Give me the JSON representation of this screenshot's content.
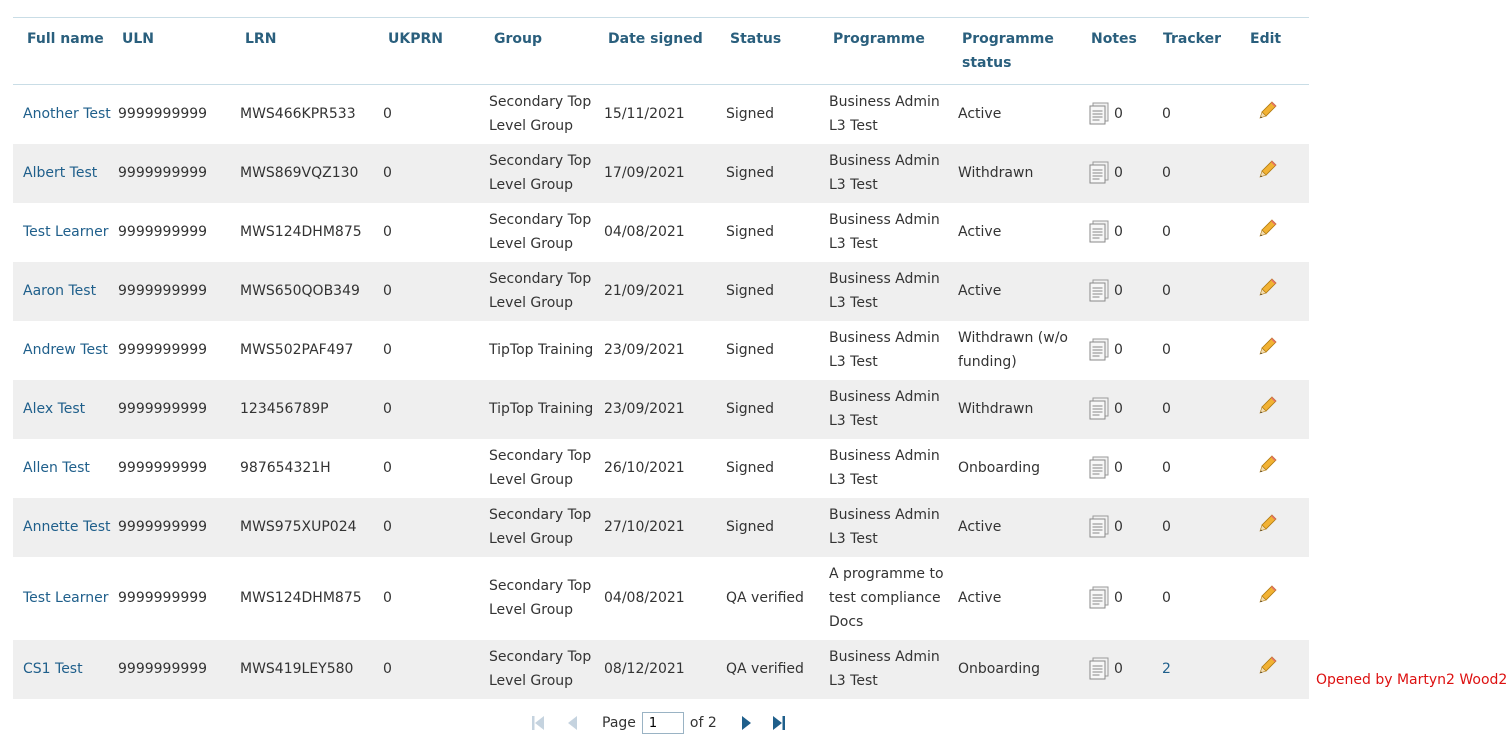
{
  "columns": [
    "Full name",
    "ULN",
    "LRN",
    "UKPRN",
    "Group",
    "Date signed",
    "Status",
    "Programme",
    "Programme status",
    "Notes",
    "Tracker",
    "Edit"
  ],
  "rows": [
    {
      "name": "Another Test",
      "uln": "9999999999",
      "lrn": "MWS466KPR533",
      "ukprn": "0",
      "group": "Secondary Top Level Group",
      "date": "15/11/2021",
      "status": "Signed",
      "programme": "Business Admin L3 Test",
      "prog_status": "Active",
      "notes": "0",
      "tracker": "0"
    },
    {
      "name": "Albert Test",
      "uln": "9999999999",
      "lrn": "MWS869VQZ130",
      "ukprn": "0",
      "group": "Secondary Top Level Group",
      "date": "17/09/2021",
      "status": "Signed",
      "programme": "Business Admin L3 Test",
      "prog_status": "Withdrawn",
      "notes": "0",
      "tracker": "0"
    },
    {
      "name": "Test Learner",
      "uln": "9999999999",
      "lrn": "MWS124DHM875",
      "ukprn": "0",
      "group": "Secondary Top Level Group",
      "date": "04/08/2021",
      "status": "Signed",
      "programme": "Business Admin L3 Test",
      "prog_status": "Active",
      "notes": "0",
      "tracker": "0"
    },
    {
      "name": "Aaron Test",
      "uln": "9999999999",
      "lrn": "MWS650QOB349",
      "ukprn": "0",
      "group": "Secondary Top Level Group",
      "date": "21/09/2021",
      "status": "Signed",
      "programme": "Business Admin L3 Test",
      "prog_status": "Active",
      "notes": "0",
      "tracker": "0"
    },
    {
      "name": "Andrew Test",
      "uln": "9999999999",
      "lrn": "MWS502PAF497",
      "ukprn": "0",
      "group": "TipTop Training",
      "date": "23/09/2021",
      "status": "Signed",
      "programme": "Business Admin L3 Test",
      "prog_status": "Withdrawn (w/o funding)",
      "notes": "0",
      "tracker": "0"
    },
    {
      "name": "Alex Test",
      "uln": "9999999999",
      "lrn": "123456789P",
      "ukprn": "0",
      "group": "TipTop Training",
      "date": "23/09/2021",
      "status": "Signed",
      "programme": "Business Admin L3 Test",
      "prog_status": "Withdrawn",
      "notes": "0",
      "tracker": "0"
    },
    {
      "name": "Allen Test",
      "uln": "9999999999",
      "lrn": "987654321H",
      "ukprn": "0",
      "group": "Secondary Top Level Group",
      "date": "26/10/2021",
      "status": "Signed",
      "programme": "Business Admin L3 Test",
      "prog_status": "Onboarding",
      "notes": "0",
      "tracker": "0"
    },
    {
      "name": "Annette Test",
      "uln": "9999999999",
      "lrn": "MWS975XUP024",
      "ukprn": "0",
      "group": "Secondary Top Level Group",
      "date": "27/10/2021",
      "status": "Signed",
      "programme": "Business Admin L3 Test",
      "prog_status": "Active",
      "notes": "0",
      "tracker": "0"
    },
    {
      "name": "Test Learner",
      "uln": "9999999999",
      "lrn": "MWS124DHM875",
      "ukprn": "0",
      "group": "Secondary Top Level Group",
      "date": "04/08/2021",
      "status": "QA verified",
      "programme": "A programme to test compliance Docs",
      "prog_status": "Active",
      "notes": "0",
      "tracker": "0"
    },
    {
      "name": "CS1 Test",
      "uln": "9999999999",
      "lrn": "MWS419LEY580",
      "ukprn": "0",
      "group": "Secondary Top Level Group",
      "date": "08/12/2021",
      "status": "QA verified",
      "programme": "Business Admin L3 Test",
      "prog_status": "Onboarding",
      "notes": "0",
      "tracker": "2"
    }
  ],
  "row_note": "Opened by Martyn2 Wood2",
  "pagination": {
    "page_label": "Page",
    "current_page": "1",
    "of_label": "of 2"
  },
  "colors": {
    "header_text": "#2a5f7d",
    "link": "#1f5f8b",
    "row_alt": "#efefef",
    "alert": "#dd1111"
  },
  "icons": {
    "notes": "notes-document-icon",
    "edit": "pencil-edit-icon",
    "first": "first-page-icon",
    "prev": "prev-page-icon",
    "next": "next-page-icon",
    "last": "last-page-icon"
  }
}
